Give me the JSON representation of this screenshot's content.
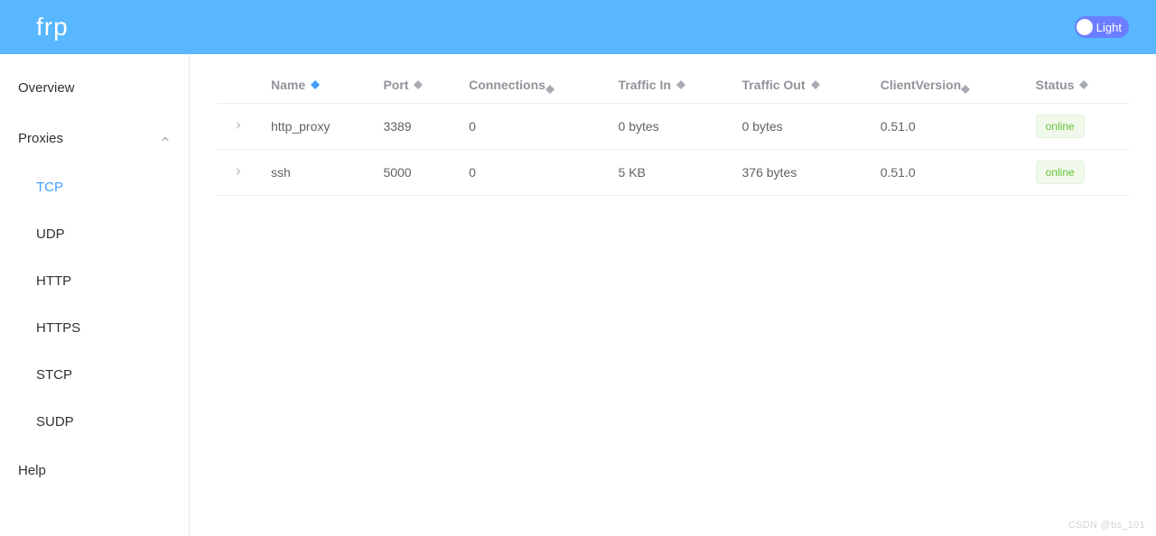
{
  "header": {
    "logo": "frp",
    "theme_label": "Light"
  },
  "sidebar": {
    "overview": "Overview",
    "proxies": "Proxies",
    "items": [
      {
        "label": "TCP",
        "active": true
      },
      {
        "label": "UDP",
        "active": false
      },
      {
        "label": "HTTP",
        "active": false
      },
      {
        "label": "HTTPS",
        "active": false
      },
      {
        "label": "STCP",
        "active": false
      },
      {
        "label": "SUDP",
        "active": false
      }
    ],
    "help": "Help"
  },
  "table": {
    "columns": {
      "name": "Name",
      "port": "Port",
      "connections": "Connections",
      "traffic_in": "Traffic In",
      "traffic_out": "Traffic Out",
      "client_version": "ClientVersion",
      "status": "Status"
    },
    "rows": [
      {
        "name": "http_proxy",
        "port": "3389",
        "connections": "0",
        "traffic_in": "0 bytes",
        "traffic_out": "0 bytes",
        "client_version": "0.51.0",
        "status": "online"
      },
      {
        "name": "ssh",
        "port": "5000",
        "connections": "0",
        "traffic_in": "5 KB",
        "traffic_out": "376 bytes",
        "client_version": "0.51.0",
        "status": "online"
      }
    ]
  },
  "watermark": "CSDN @bs_101"
}
